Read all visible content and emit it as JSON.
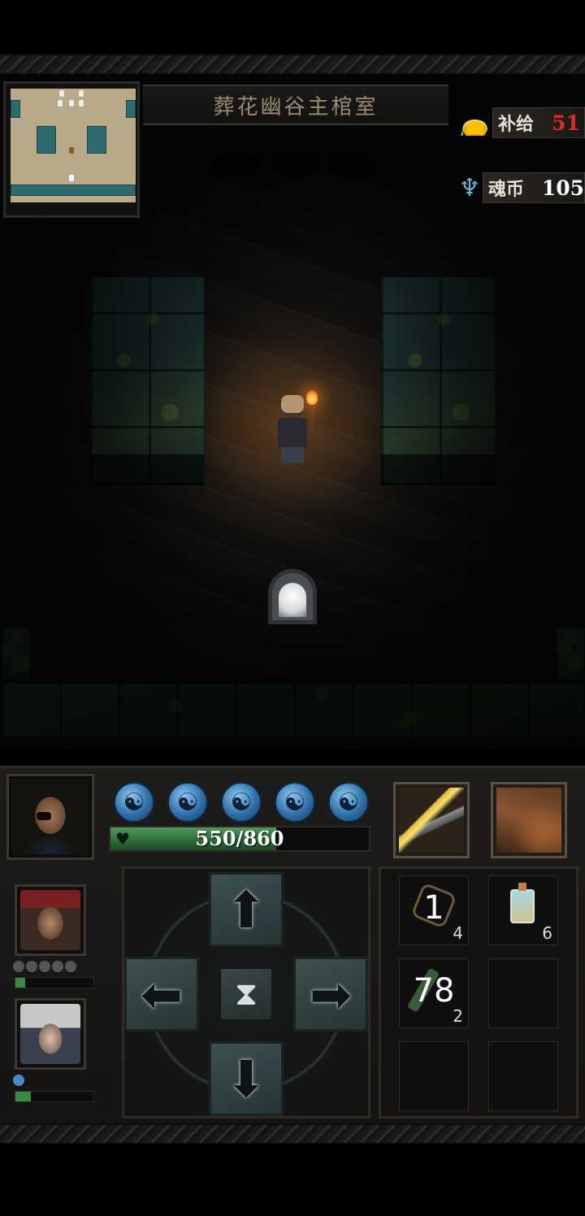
{
  "location": {
    "name": "葬花幽谷主棺室"
  },
  "resources": {
    "supply": {
      "label": "补给",
      "value": "51",
      "color": "#e02a2a",
      "icon": "supply-bag-icon"
    },
    "soul_coins": {
      "label": "魂币",
      "value": "105",
      "color": "#ffffff",
      "icon": "soul-coin-icon"
    }
  },
  "hero": {
    "hp_text": "550/860",
    "hp_fraction": 0.64,
    "skill_orbs": [
      "☯",
      "☯",
      "☯",
      "☯",
      "☯"
    ],
    "orb_icon": "yin-yang-orb-icon"
  },
  "abilities": [
    {
      "name": "flaming-sword-skill-icon"
    },
    {
      "name": "claw-strike-skill-icon"
    }
  ],
  "party": [
    {
      "name": "pirate-companion",
      "orbs_on": 0,
      "hp_fraction": 0.12
    },
    {
      "name": "goggles-companion",
      "orbs_on": 1,
      "hp_fraction": 0.2
    }
  ],
  "dpad": {
    "up": "⬆",
    "left": "⬅",
    "right": "➡",
    "down": "⬇",
    "wait": "⧗"
  },
  "inventory": [
    {
      "icon": "bagua-talisman-icon",
      "big": "1",
      "qty": "4"
    },
    {
      "icon": "potion-bottle-icon",
      "big": "",
      "qty": "6"
    },
    {
      "icon": "scroll-icon",
      "big": "78",
      "qty": "2"
    },
    {
      "icon": "empty-slot",
      "big": "",
      "qty": ""
    },
    {
      "icon": "empty-slot",
      "big": "",
      "qty": ""
    },
    {
      "icon": "empty-slot",
      "big": "",
      "qty": ""
    }
  ]
}
